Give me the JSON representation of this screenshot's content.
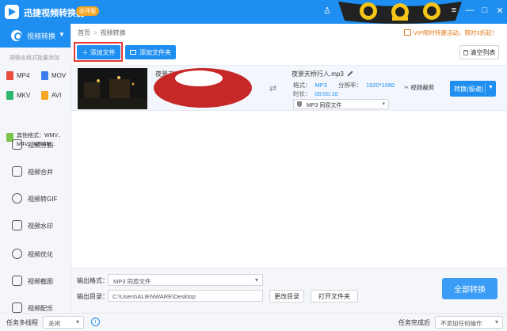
{
  "app": {
    "title": "迅捷视频转换器",
    "badge": "@评版"
  },
  "window": {
    "minimize": "—",
    "maximize": "□",
    "close": "✕",
    "user": "♙",
    "menu": "≡"
  },
  "sidebar": {
    "active": {
      "label": "视频转换",
      "icon": "convert-icon"
    },
    "hint": "按输出格式批量添加",
    "formats": [
      {
        "label": "MP4",
        "color": "#e94b3c"
      },
      {
        "label": "MOV",
        "color": "#3d7cf0"
      },
      {
        "label": "MKV",
        "color": "#2eb872"
      },
      {
        "label": "AVI",
        "color": "#f5a623"
      }
    ],
    "other_formats": [
      "其他格式：WMV、",
      "M4V、WEBM..."
    ],
    "nav": [
      {
        "label": "视频分割",
        "icon": "split-icon"
      },
      {
        "label": "视频合并",
        "icon": "merge-icon"
      },
      {
        "label": "视频转GIF",
        "icon": "gif-icon"
      },
      {
        "label": "视频水印",
        "icon": "watermark-icon"
      },
      {
        "label": "视频优化",
        "icon": "optimize-icon"
      },
      {
        "label": "视频截图",
        "icon": "screenshot-icon"
      },
      {
        "label": "视频配乐",
        "icon": "music-icon"
      }
    ]
  },
  "breadcrumb": {
    "home": "首页",
    "separator": ">",
    "current": "视频转换"
  },
  "promo": "VIP限时特惠活动，限时5折起！",
  "toolbar": {
    "add_file": "＋ 添加文件",
    "add_folder": "添加文件夹",
    "clear_list": "清空列表"
  },
  "file": {
    "source_name": "夜景下",
    "output_name": "夜景天桥行人.mp3",
    "format_label": "格式：",
    "format_value": "MP3",
    "resolution_label": "分辨率：",
    "resolution_value": "1920*1080",
    "duration_label": "时长：",
    "duration_value": "00:00:10",
    "output_select": "MP3  同原文件",
    "cut_label": "视频裁剪",
    "convert_label": "转换(极速)",
    "convert_arrow": "▼"
  },
  "bottom": {
    "format_label": "输出格式：",
    "format_value": "MP3  同原文件",
    "dir_label": "输出目录：",
    "dir_value": "C:\\Users\\ALIENWARE\\Desktop",
    "change_dir": "更改目录",
    "open_folder": "打开文件夹",
    "convert_all": "全部转换"
  },
  "status": {
    "threads_label": "任务多线程",
    "threads_value": "关闭",
    "info": "i",
    "done_label": "任务完成后",
    "done_value": "不添加任何操作"
  },
  "colors": {
    "brand": "#1e8ef0",
    "promo": "#e07a18",
    "highlight": "#e53935",
    "redaction": "#c62828"
  }
}
